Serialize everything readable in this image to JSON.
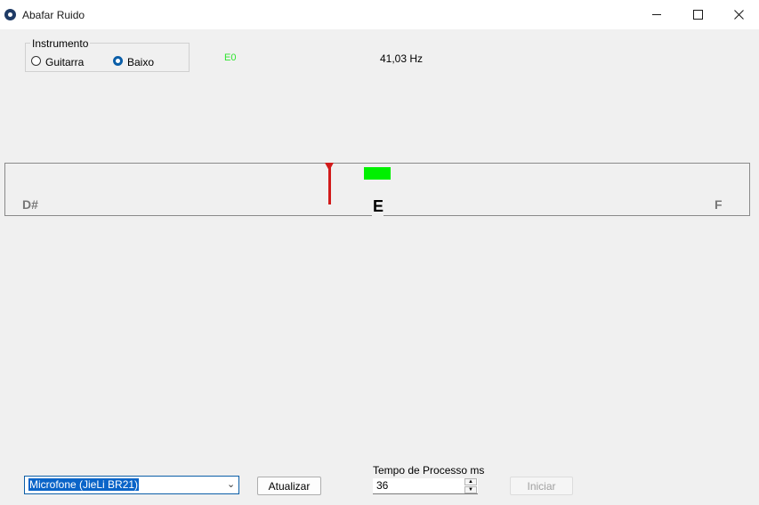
{
  "window": {
    "title": "Abafar Ruido",
    "icon": "paw-icon",
    "controls": [
      "minimize-icon",
      "maximize-icon",
      "close-icon"
    ]
  },
  "instrument": {
    "legend": "Instrumento",
    "options": [
      {
        "label": "Guitarra",
        "selected": false
      },
      {
        "label": "Baixo",
        "selected": true
      }
    ]
  },
  "reading": {
    "note_code": "E0",
    "frequency": "41,03 Hz"
  },
  "tuner": {
    "left_note": "D#",
    "center_note": "E",
    "right_note": "F",
    "needle_color": "#d11b1b",
    "in_tune_color": "#00f000"
  },
  "controls": {
    "device": "Microfone (JieLi BR21)",
    "refresh_label": "Atualizar",
    "process_time_label": "Tempo de Processo ms",
    "process_time_value": "36",
    "start_label": "Iniciar"
  },
  "colors": {
    "accent": "#0b5ea8",
    "note_code": "#2fe52f",
    "background": "#f0f0f0"
  }
}
